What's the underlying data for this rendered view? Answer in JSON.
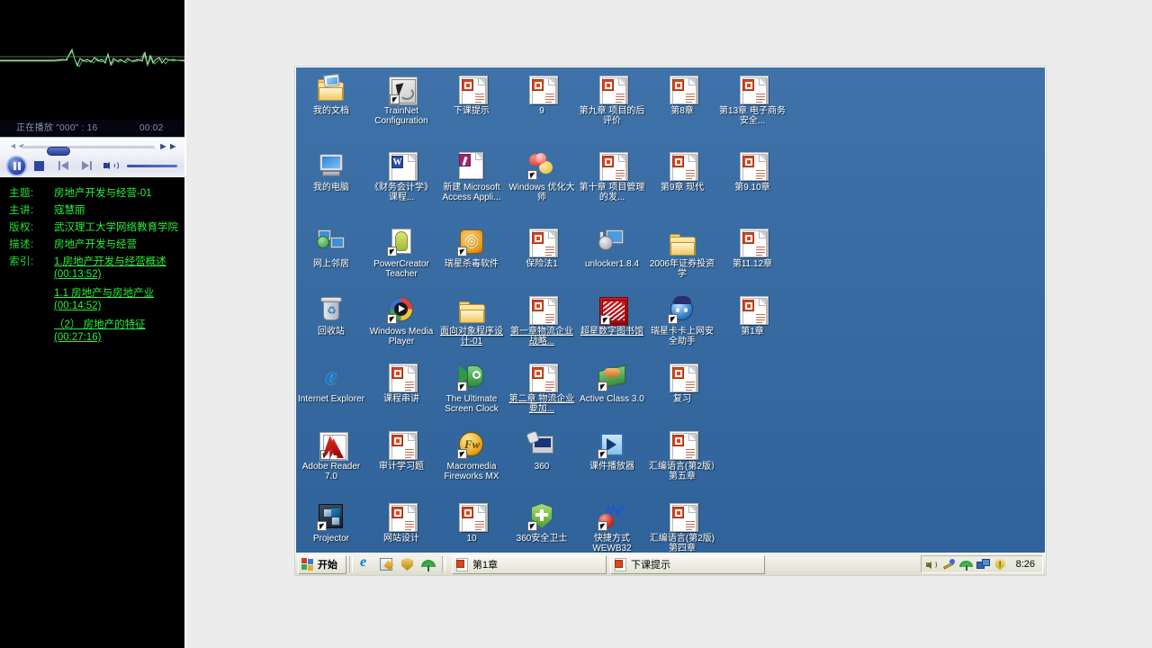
{
  "player": {
    "now_playing_label": "正在播放 \"000\" : 16",
    "elapsed": "00:02",
    "controls": {
      "play_pause": "pause-button",
      "stop": "stop-button",
      "previous": "previous-track-button",
      "next": "next-track-button",
      "volume": "volume-button"
    },
    "seek_left": "◄◄",
    "seek_right": "►►"
  },
  "course": {
    "labels": {
      "subject": "主题:",
      "speaker": "主讲:",
      "copyright": "版权:",
      "description": "描述:",
      "index": "索引:"
    },
    "subject": "房地产开发与经营-01",
    "speaker": "寇慧丽",
    "copyright": "武汉理工大学网络教育学院",
    "description": "房地产开发与经营",
    "index_links": [
      "1.房地产开发与经营概述(00:13:52)",
      "1.1 房地产与房地产业(00:14:52)",
      "（2） 房地产的特征(00:27:16)"
    ]
  },
  "desktop": {
    "background_color": "#35699f",
    "icons": [
      {
        "label": "我的文档",
        "art": "mydocs",
        "shortcut": false,
        "underline": false
      },
      {
        "label": "TrainNet Configuration",
        "art": "trainnet",
        "shortcut": true,
        "underline": false
      },
      {
        "label": "下课提示",
        "art": "ppt",
        "shortcut": false,
        "underline": false
      },
      {
        "label": "9",
        "art": "ppt",
        "shortcut": false,
        "underline": false
      },
      {
        "label": "第九章 项目的后评价",
        "art": "ppt",
        "shortcut": false,
        "underline": false
      },
      {
        "label": "第8章",
        "art": "ppt",
        "shortcut": false,
        "underline": false
      },
      {
        "label": "第13章 电子商务安全...",
        "art": "ppt",
        "shortcut": false,
        "underline": false
      },
      {
        "label": "我的电脑",
        "art": "mypc",
        "shortcut": false,
        "underline": false
      },
      {
        "label": "《财务会计学》课程...",
        "art": "word",
        "shortcut": false,
        "underline": false
      },
      {
        "label": "新建 Microsoft Access Appli...",
        "art": "access",
        "shortcut": false,
        "underline": false
      },
      {
        "label": "Windows 优化大师",
        "art": "wopt",
        "shortcut": true,
        "underline": false
      },
      {
        "label": "第十章 项目管理的发...",
        "art": "ppt",
        "shortcut": false,
        "underline": false
      },
      {
        "label": "第9章 现代",
        "art": "ppt",
        "shortcut": false,
        "underline": false
      },
      {
        "label": "第9.10章",
        "art": "ppt",
        "shortcut": false,
        "underline": false
      },
      {
        "label": "网上邻居",
        "art": "net",
        "shortcut": false,
        "underline": false
      },
      {
        "label": "PowerCreator Teacher",
        "art": "pcteach",
        "shortcut": true,
        "underline": false
      },
      {
        "label": "瑞星杀毒软件",
        "art": "rising",
        "shortcut": true,
        "underline": false
      },
      {
        "label": "保险法1",
        "art": "ppt",
        "shortcut": false,
        "underline": false
      },
      {
        "label": "unlocker1.8.4",
        "art": "unlocker",
        "shortcut": false,
        "underline": false
      },
      {
        "label": "2006年证券投资学",
        "art": "folder",
        "shortcut": false,
        "underline": false
      },
      {
        "label": "第11.12章",
        "art": "ppt",
        "shortcut": false,
        "underline": false
      },
      {
        "label": "回收站",
        "art": "bin",
        "shortcut": false,
        "underline": false
      },
      {
        "label": "Windows Media Player",
        "art": "wmp",
        "shortcut": true,
        "underline": false
      },
      {
        "label": "面向对象程序设计-01",
        "art": "folder",
        "shortcut": false,
        "underline": true
      },
      {
        "label": "第一章物流企业战略...",
        "art": "ppt",
        "shortcut": false,
        "underline": true
      },
      {
        "label": "超星数字图书馆",
        "art": "star",
        "shortcut": true,
        "underline": true
      },
      {
        "label": "瑞星卡卡上网安全助手",
        "art": "kaka",
        "shortcut": true,
        "underline": false
      },
      {
        "label": "第1章",
        "art": "ppt",
        "shortcut": false,
        "underline": false
      },
      {
        "label": "Internet Explorer",
        "art": "ie",
        "shortcut": false,
        "underline": false
      },
      {
        "label": "课程串讲",
        "art": "ppt",
        "shortcut": false,
        "underline": false
      },
      {
        "label": "The Ultimate Screen Clock",
        "art": "clock",
        "shortcut": true,
        "underline": false
      },
      {
        "label": "第二章 物流企业要加...",
        "art": "ppt",
        "shortcut": false,
        "underline": true
      },
      {
        "label": "Active Class 3.0",
        "art": "active",
        "shortcut": true,
        "underline": false
      },
      {
        "label": "复习",
        "art": "ppt",
        "shortcut": false,
        "underline": false
      },
      {
        "label": "Adobe Reader 7.0",
        "art": "adobe",
        "shortcut": true,
        "underline": false
      },
      {
        "label": "审计学习题",
        "art": "ppt",
        "shortcut": false,
        "underline": false
      },
      {
        "label": "Macromedia Fireworks MX",
        "art": "fw",
        "shortcut": true,
        "underline": false
      },
      {
        "label": "360",
        "art": "n360",
        "shortcut": false,
        "underline": false
      },
      {
        "label": "课件播放器",
        "art": "player",
        "shortcut": true,
        "underline": false
      },
      {
        "label": "汇编语言(第2版）第五章",
        "art": "ppt",
        "shortcut": false,
        "underline": false
      },
      {
        "label": "Projector",
        "art": "projector",
        "shortcut": true,
        "underline": false
      },
      {
        "label": "网站设计",
        "art": "ppt",
        "shortcut": false,
        "underline": false
      },
      {
        "label": "10",
        "art": "ppt",
        "shortcut": false,
        "underline": false
      },
      {
        "label": "360安全卫士",
        "art": "shield",
        "shortcut": true,
        "underline": false
      },
      {
        "label": "快捷方式 WEWB32",
        "art": "wave",
        "shortcut": true,
        "underline": false
      },
      {
        "label": "汇编语言(第2版)第四章",
        "art": "ppt",
        "shortcut": false,
        "underline": false
      }
    ]
  },
  "taskbar": {
    "start_label": "开始",
    "quick_launch": [
      "internet-explorer-icon",
      "show-desktop-icon",
      "shield-icon",
      "umbrella-icon"
    ],
    "tasks": [
      {
        "label": "第1章"
      },
      {
        "label": "下课提示"
      }
    ],
    "tray_icons": [
      "volume-icon",
      "wrench-icon",
      "umbrella-icon",
      "network-icon",
      "warning-shield-icon"
    ],
    "clock": "8:26"
  }
}
